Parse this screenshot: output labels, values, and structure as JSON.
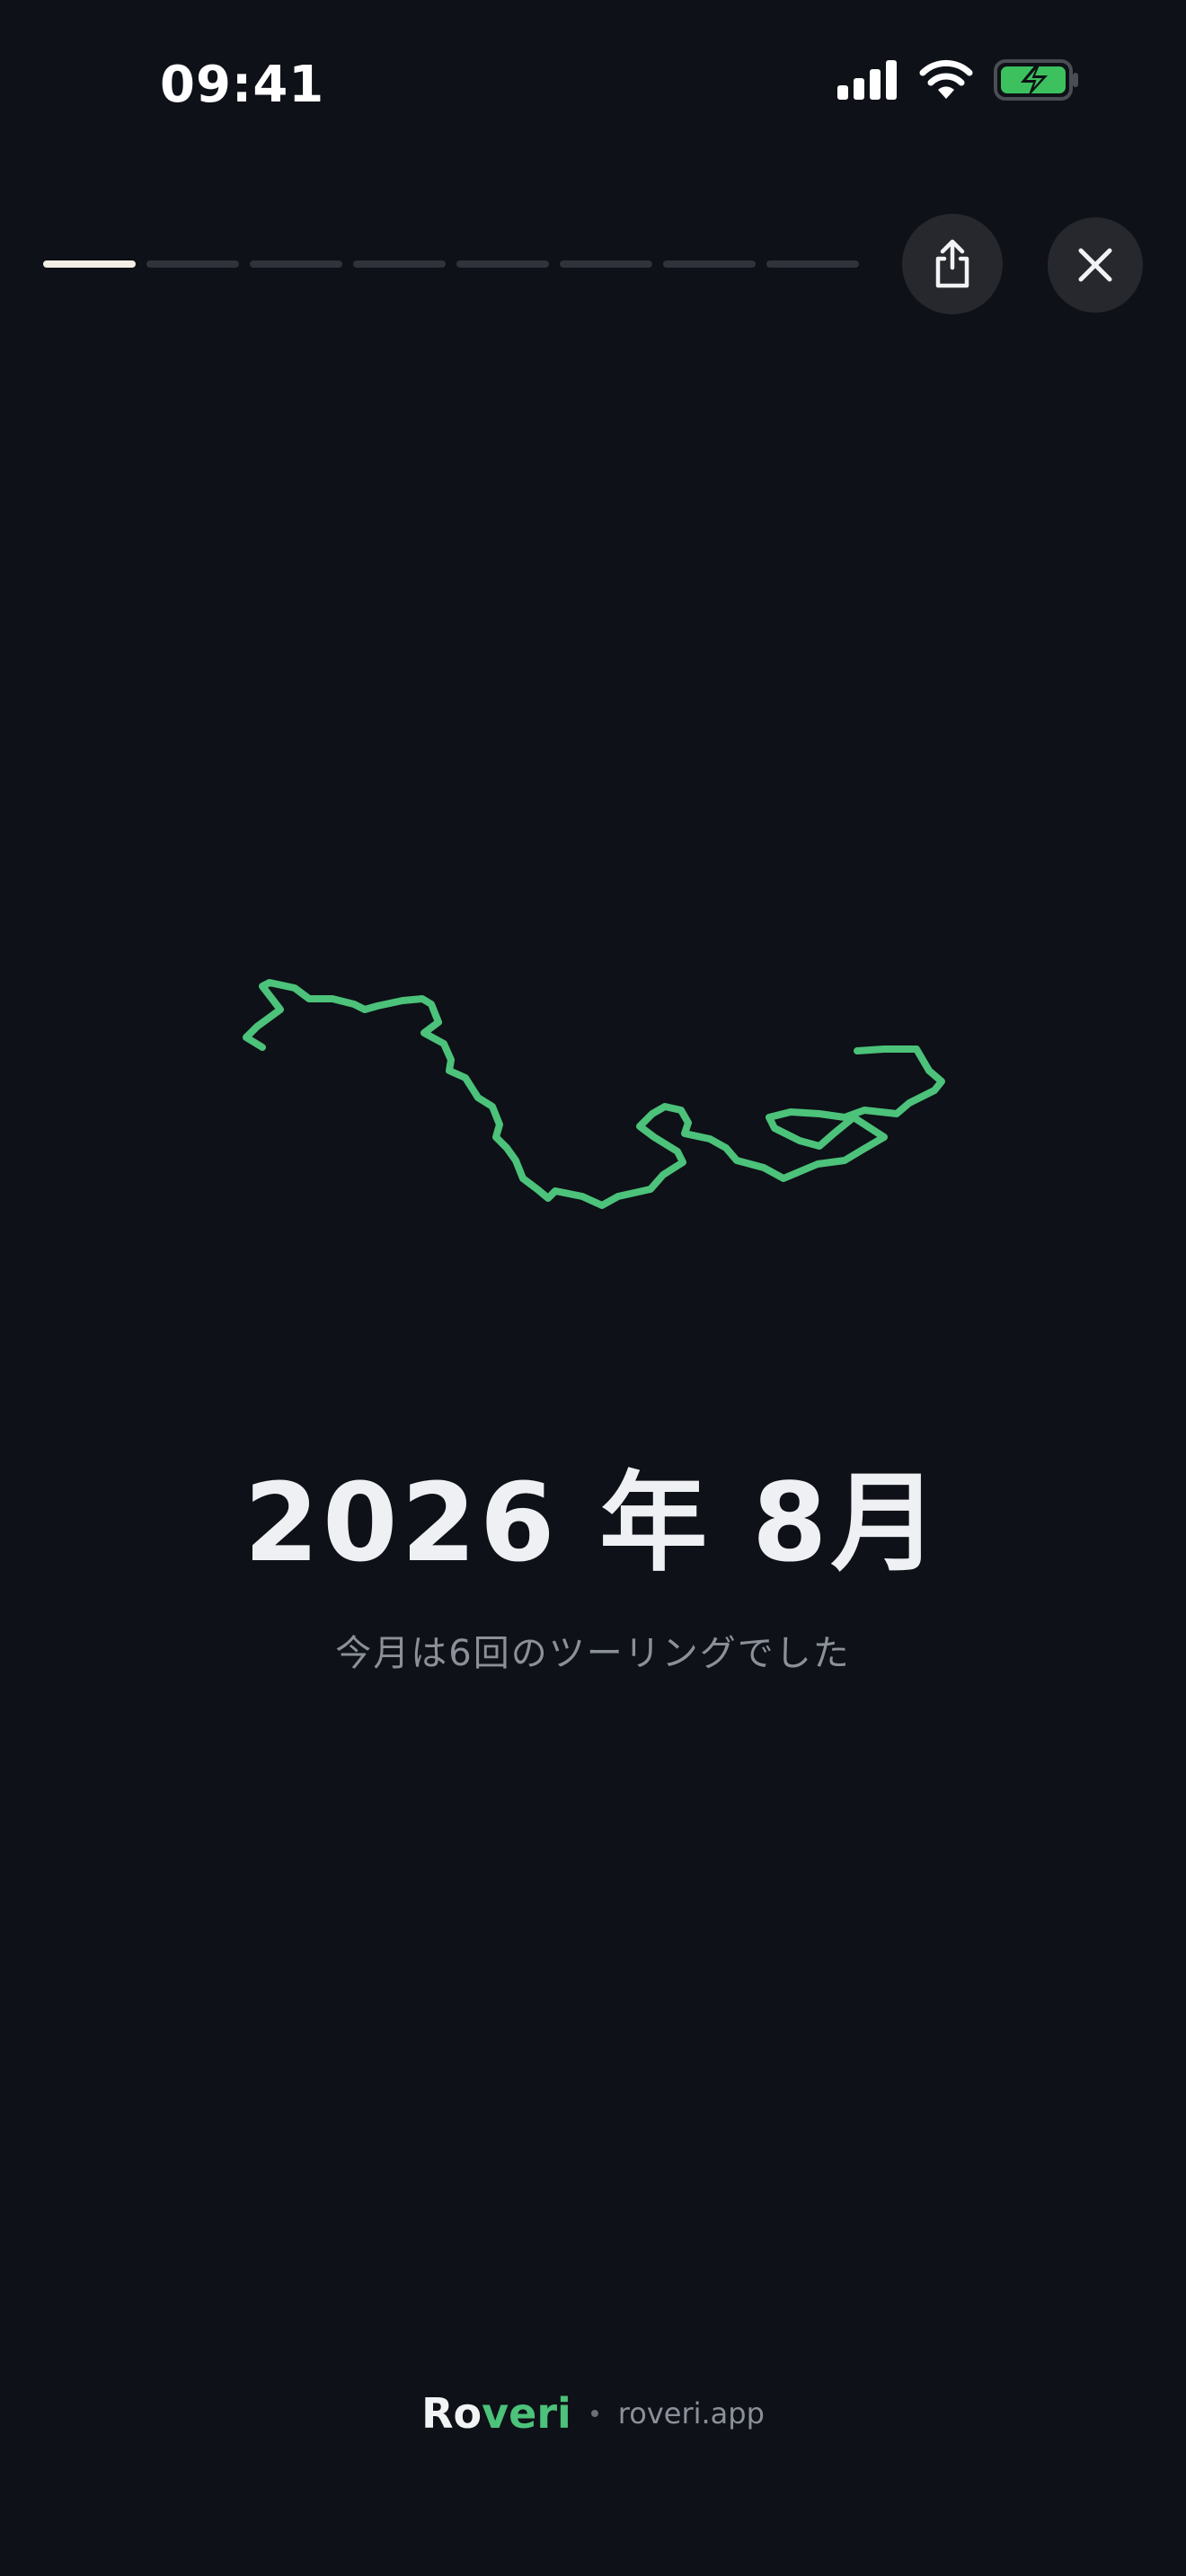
{
  "status_bar": {
    "time": "09:41",
    "icons": [
      "signal-icon",
      "wifi-icon",
      "battery-charging-icon"
    ]
  },
  "story": {
    "segment_count": 8,
    "active_segment": 1
  },
  "header": {
    "share_icon": "share-icon",
    "close_icon": "close-icon"
  },
  "main": {
    "title": "2026 年 8月",
    "subtitle": "今月は6回のツーリングでした",
    "route_color": "#4cc27a"
  },
  "footer": {
    "brand_ro": "Ro",
    "brand_veri": "veri",
    "domain": "roveri.app"
  }
}
